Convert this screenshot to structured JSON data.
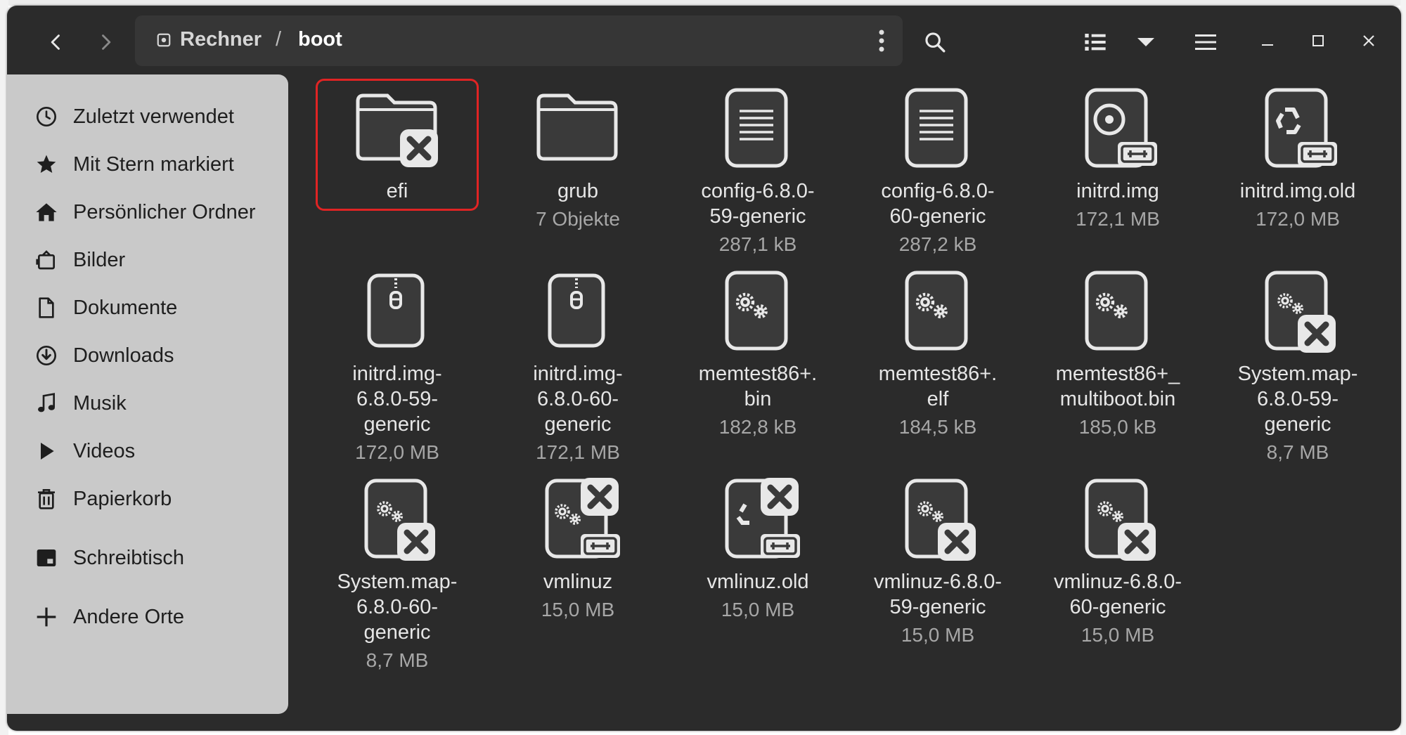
{
  "window": {
    "path": [
      "Rechner",
      "boot"
    ],
    "path_separator": "/"
  },
  "sidebar": {
    "items": [
      {
        "label": "Zuletzt verwendet",
        "icon": "clock-icon"
      },
      {
        "label": "Mit Stern markiert",
        "icon": "star-icon"
      },
      {
        "label": "Persönlicher Ordner",
        "icon": "home-icon"
      },
      {
        "label": "Bilder",
        "icon": "pictures-icon"
      },
      {
        "label": "Dokumente",
        "icon": "document-icon"
      },
      {
        "label": "Downloads",
        "icon": "download-icon"
      },
      {
        "label": "Musik",
        "icon": "music-icon"
      },
      {
        "label": "Videos",
        "icon": "play-icon"
      },
      {
        "label": "Papierkorb",
        "icon": "trash-icon"
      },
      {
        "label": "Schreibtisch",
        "icon": "desktop-icon"
      },
      {
        "label": "Andere Orte",
        "icon": "plus-icon"
      }
    ]
  },
  "files": [
    {
      "name": "efi",
      "size": "",
      "icon": "folder-broken-icon",
      "selected": true
    },
    {
      "name": "grub",
      "size": "7 Objekte",
      "icon": "folder-icon"
    },
    {
      "name": "config-6.8.0-\n59-generic",
      "size": "287,1 kB",
      "icon": "text-file-icon"
    },
    {
      "name": "config-6.8.0-\n60-generic",
      "size": "287,2 kB",
      "icon": "text-file-icon"
    },
    {
      "name": "initrd.img",
      "size": "172,1 MB",
      "icon": "disc-image-link-icon"
    },
    {
      "name": "initrd.img.old",
      "size": "172,0 MB",
      "icon": "recycle-link-icon"
    },
    {
      "name": "initrd.img-\n6.8.0-59-\ngeneric",
      "size": "172,0 MB",
      "icon": "zip-archive-icon"
    },
    {
      "name": "initrd.img-\n6.8.0-60-\ngeneric",
      "size": "172,1 MB",
      "icon": "zip-archive-icon"
    },
    {
      "name": "memtest86+.\nbin",
      "size": "182,8 kB",
      "icon": "executable-icon"
    },
    {
      "name": "memtest86+.\nelf",
      "size": "184,5 kB",
      "icon": "executable-icon"
    },
    {
      "name": "memtest86+_\nmultiboot.bin",
      "size": "185,0 kB",
      "icon": "executable-icon"
    },
    {
      "name": "System.map-\n6.8.0-59-\ngeneric",
      "size": "8,7 MB",
      "icon": "executable-broken-icon"
    },
    {
      "name": "System.map-\n6.8.0-60-\ngeneric",
      "size": "8,7 MB",
      "icon": "executable-broken-icon"
    },
    {
      "name": "vmlinuz",
      "size": "15,0 MB",
      "icon": "executable-broken-link-icon"
    },
    {
      "name": "vmlinuz.old",
      "size": "15,0 MB",
      "icon": "recycle-broken-link-icon"
    },
    {
      "name": "vmlinuz-6.8.0-\n59-generic",
      "size": "15,0 MB",
      "icon": "executable-broken-icon"
    },
    {
      "name": "vmlinuz-6.8.0-\n60-generic",
      "size": "15,0 MB",
      "icon": "executable-broken-icon"
    }
  ]
}
